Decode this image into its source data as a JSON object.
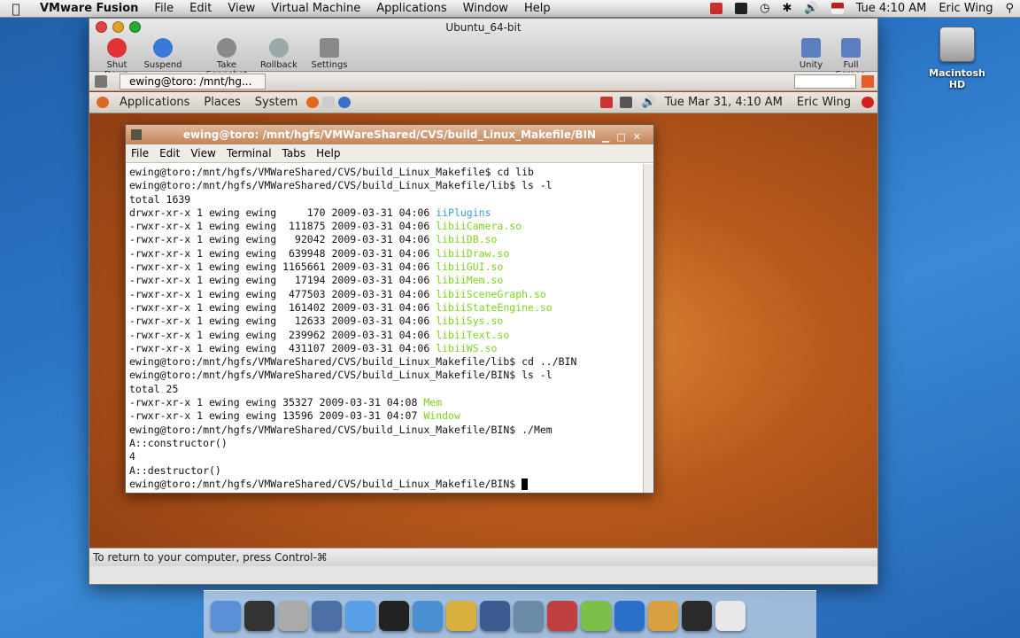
{
  "mac_menubar": {
    "app": "VMware Fusion",
    "menus": [
      "File",
      "Edit",
      "View",
      "Virtual Machine",
      "Applications",
      "Window",
      "Help"
    ],
    "clock": "Tue 4:10 AM",
    "user": "Eric Wing"
  },
  "desktop": {
    "hd_label": "Macintosh HD"
  },
  "vm_window": {
    "title": "Ubuntu_64-bit",
    "toolbar": {
      "shut_down": "Shut Down",
      "suspend": "Suspend",
      "take_snapshot": "Take Snapshot",
      "rollback": "Rollback",
      "settings": "Settings",
      "unity": "Unity",
      "full_screen": "Full Screen"
    },
    "status": "To return to your computer, press Control-⌘"
  },
  "ubuntu": {
    "taskbar_item": "ewing@toro: /mnt/hg...",
    "panel": {
      "applications": "Applications",
      "places": "Places",
      "system": "System",
      "datetime": "Tue Mar 31,  4:10 AM",
      "user": "Eric Wing"
    }
  },
  "terminal": {
    "title": "ewing@toro: /mnt/hgfs/VMWareShared/CVS/build_Linux_Makefile/BIN",
    "menu": [
      "File",
      "Edit",
      "View",
      "Terminal",
      "Tabs",
      "Help"
    ],
    "lines": [
      {
        "text": "ewing@toro:/mnt/hgfs/VMWareShared/CVS/build_Linux_Makefile$ cd lib",
        "color": ""
      },
      {
        "text": "ewing@toro:/mnt/hgfs/VMWareShared/CVS/build_Linux_Makefile/lib$ ls -l",
        "color": ""
      },
      {
        "text": "total 1639",
        "color": ""
      },
      {
        "text": "drwxr-xr-x 1 ewing ewing     170 2009-03-31 04:06 ",
        "hl": "iiPlugins",
        "color": "#3a9bdc"
      },
      {
        "text": "-rwxr-xr-x 1 ewing ewing  111875 2009-03-31 04:06 ",
        "hl": "libiiCamera.so",
        "color": "#7ed321"
      },
      {
        "text": "-rwxr-xr-x 1 ewing ewing   92042 2009-03-31 04:06 ",
        "hl": "libiiDB.so",
        "color": "#7ed321"
      },
      {
        "text": "-rwxr-xr-x 1 ewing ewing  639948 2009-03-31 04:06 ",
        "hl": "libiiDraw.so",
        "color": "#7ed321"
      },
      {
        "text": "-rwxr-xr-x 1 ewing ewing 1165661 2009-03-31 04:06 ",
        "hl": "libiiGUI.so",
        "color": "#7ed321"
      },
      {
        "text": "-rwxr-xr-x 1 ewing ewing   17194 2009-03-31 04:06 ",
        "hl": "libiiMem.so",
        "color": "#7ed321"
      },
      {
        "text": "-rwxr-xr-x 1 ewing ewing  477503 2009-03-31 04:06 ",
        "hl": "libiiSceneGraph.so",
        "color": "#7ed321"
      },
      {
        "text": "-rwxr-xr-x 1 ewing ewing  161402 2009-03-31 04:06 ",
        "hl": "libiiStateEngine.so",
        "color": "#7ed321"
      },
      {
        "text": "-rwxr-xr-x 1 ewing ewing   12633 2009-03-31 04:06 ",
        "hl": "libiiSys.so",
        "color": "#7ed321"
      },
      {
        "text": "-rwxr-xr-x 1 ewing ewing  239962 2009-03-31 04:06 ",
        "hl": "libiiText.so",
        "color": "#7ed321"
      },
      {
        "text": "-rwxr-xr-x 1 ewing ewing  431107 2009-03-31 04:06 ",
        "hl": "libiiWS.so",
        "color": "#7ed321"
      },
      {
        "text": "ewing@toro:/mnt/hgfs/VMWareShared/CVS/build_Linux_Makefile/lib$ cd ../BIN",
        "color": ""
      },
      {
        "text": "ewing@toro:/mnt/hgfs/VMWareShared/CVS/build_Linux_Makefile/BIN$ ls -l",
        "color": ""
      },
      {
        "text": "total 25",
        "color": ""
      },
      {
        "text": "-rwxr-xr-x 1 ewing ewing 35327 2009-03-31 04:08 ",
        "hl": "Mem",
        "color": "#7ed321"
      },
      {
        "text": "-rwxr-xr-x 1 ewing ewing 13596 2009-03-31 04:07 ",
        "hl": "Window",
        "color": "#7ed321"
      },
      {
        "text": "ewing@toro:/mnt/hgfs/VMWareShared/CVS/build_Linux_Makefile/BIN$ ./Mem",
        "color": ""
      },
      {
        "text": "A::constructor()",
        "color": ""
      },
      {
        "text": "4",
        "color": ""
      },
      {
        "text": "A::destructor()",
        "color": ""
      },
      {
        "text": "ewing@toro:/mnt/hgfs/VMWareShared/CVS/build_Linux_Makefile/BIN$ ",
        "color": "",
        "cursor": true
      }
    ]
  },
  "dock": {
    "icons": [
      "finder-icon",
      "dashboard-icon",
      "system-preferences-icon",
      "expose-icon",
      "safari-icon",
      "terminal-icon",
      "xcode-icon",
      "interface-builder-icon",
      "instruments-icon",
      "network-icon",
      "vmware-icon",
      "ical-icon",
      "preview-icon",
      "activity-monitor-icon",
      "document-icon",
      "trash-icon"
    ],
    "colors": [
      "#5b8fd8",
      "#333",
      "#aaa",
      "#4c6fa8",
      "#5aa0e8",
      "#222",
      "#4a90d0",
      "#d8b040",
      "#3a5a90",
      "#6a8aa8",
      "#c04040",
      "#7cc04a",
      "#2a70c8",
      "#d8a040",
      "#2a2a2a",
      "#e8e8e8"
    ]
  }
}
